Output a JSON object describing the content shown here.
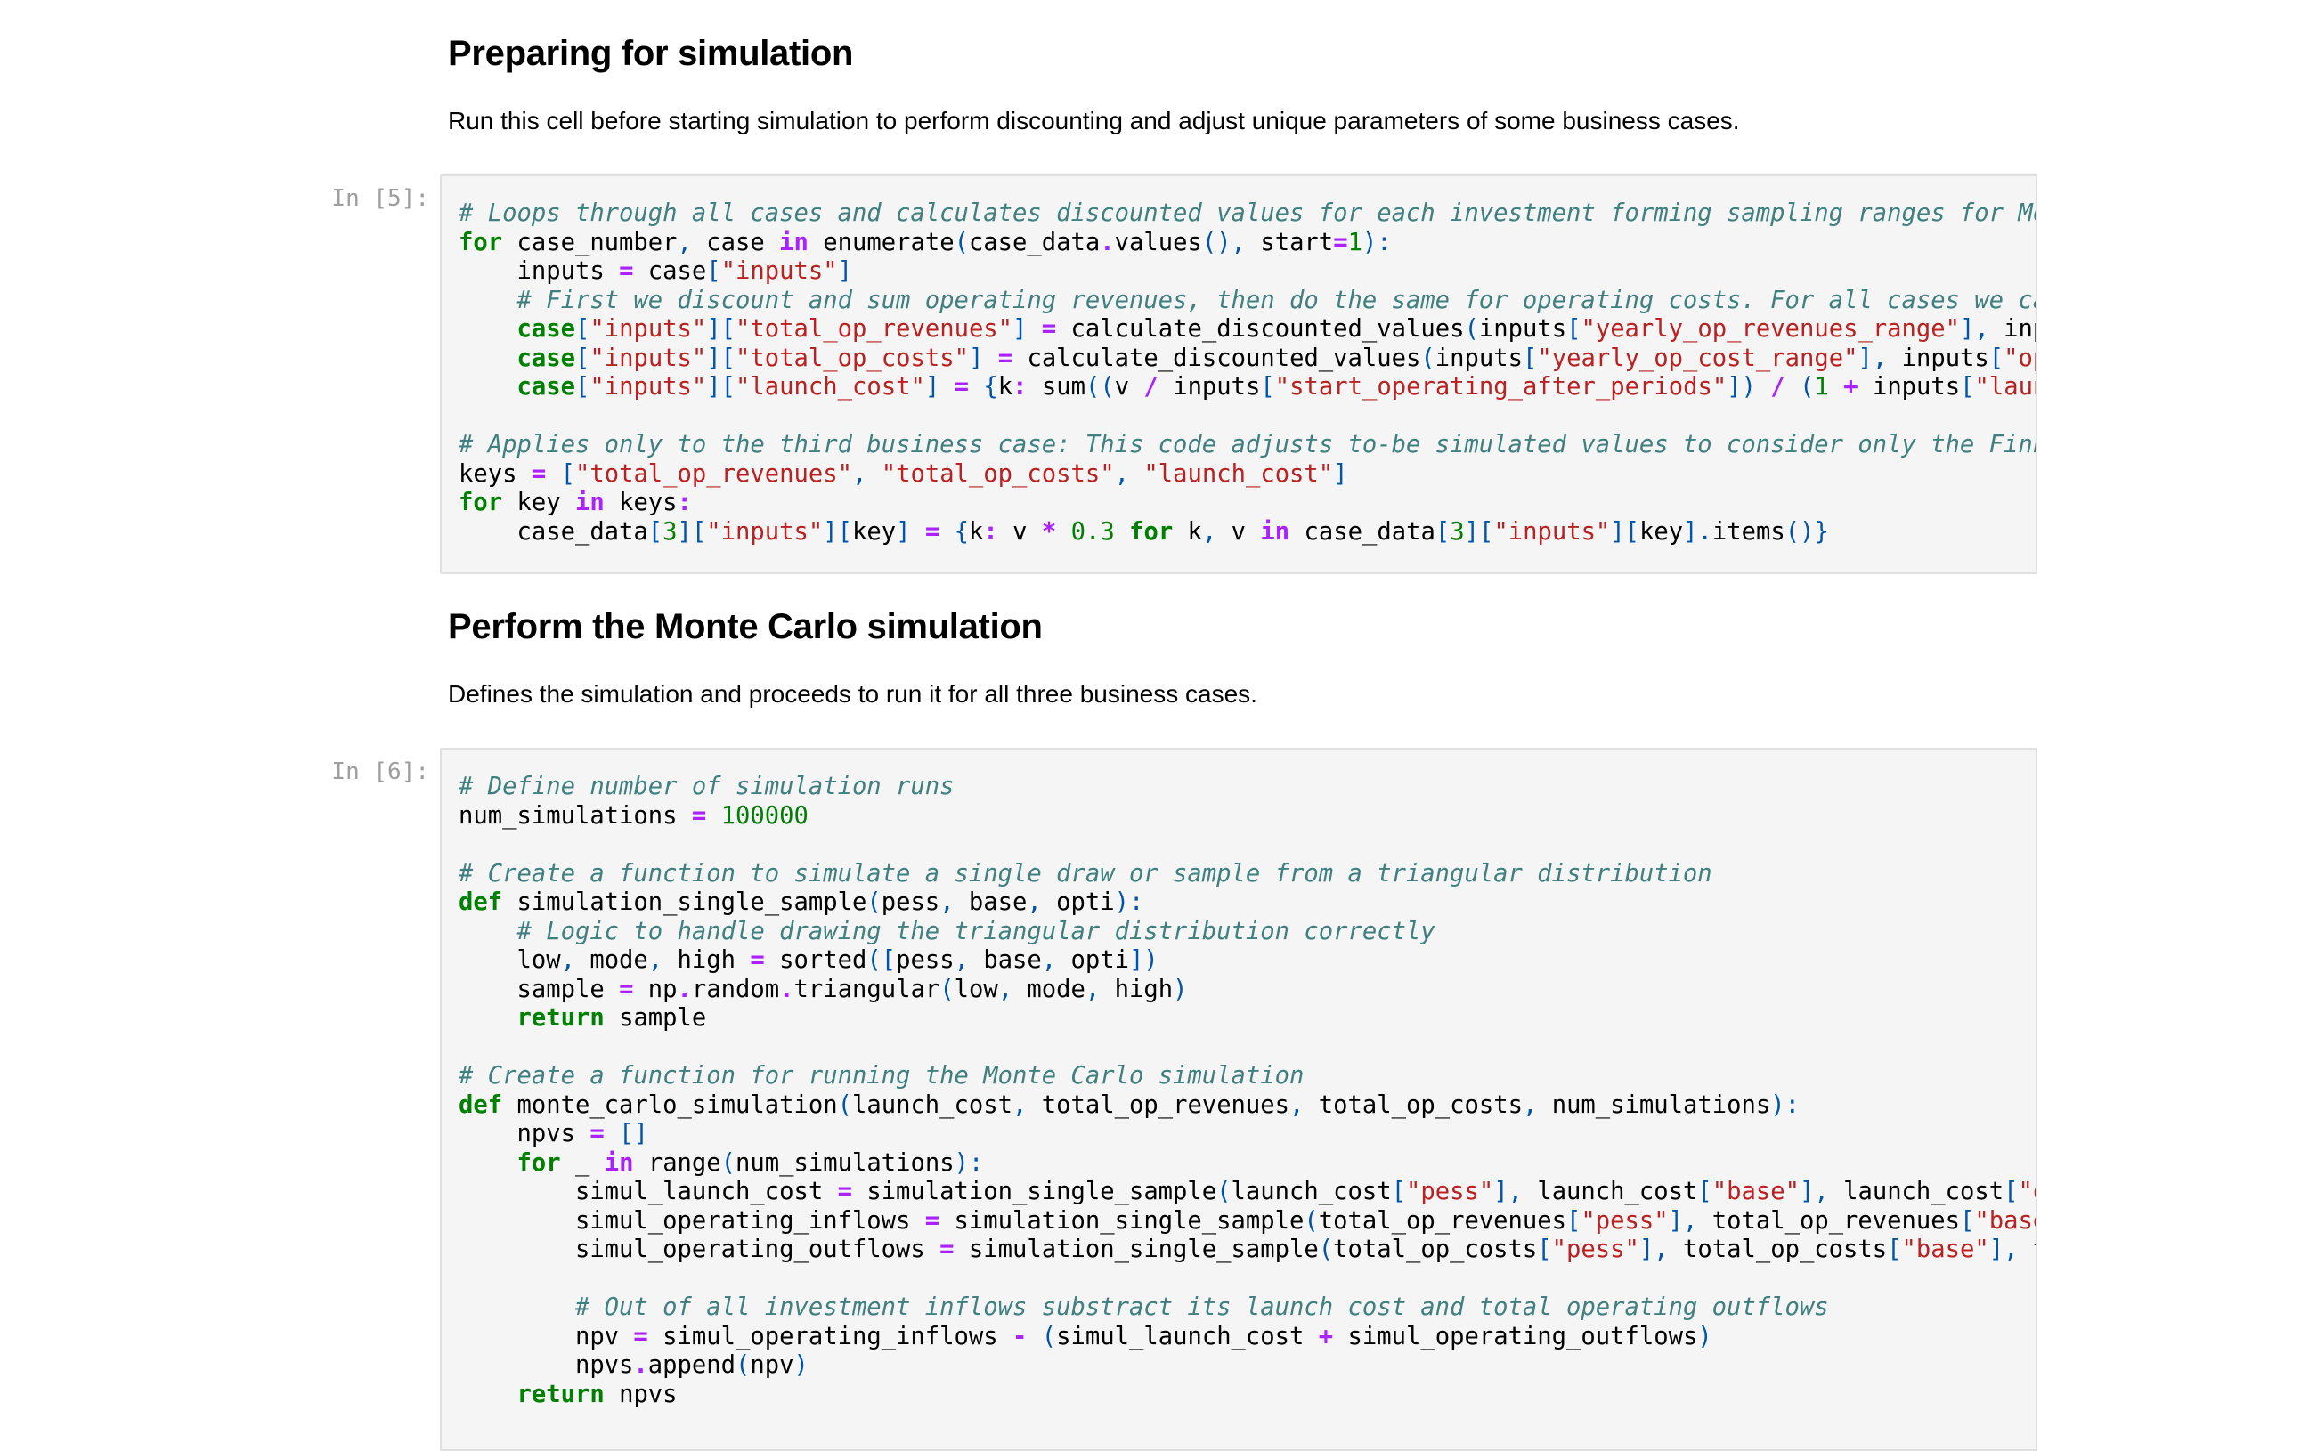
{
  "section1": {
    "heading": "Preparing for simulation",
    "description": "Run this cell before starting simulation to perform discounting and adjust unique parameters of some business cases."
  },
  "cell5": {
    "prompt": "In [5]:",
    "lines": [
      "# Loops through all cases and calculates discounted values for each investment forming sampling ranges for Monte",
      "for case_number, case in enumerate(case_data.values(), start=1):",
      "    inputs = case[\"inputs\"]",
      "    # First we discount and sum operating revenues, then do the same for operating costs. For all cases we calcul",
      "    case[\"inputs\"][\"total_op_revenues\"] = calculate_discounted_values(inputs[\"yearly_op_revenues_range\"], inputs[",
      "    case[\"inputs\"][\"total_op_costs\"] = calculate_discounted_values(inputs[\"yearly_op_cost_range\"], inputs[\"operat",
      "    case[\"inputs\"][\"launch_cost\"] = {k: sum((v / inputs[\"start_operating_after_periods\"]) / (1 + inputs[\"launch_c",
      "",
      "# Applies only to the third business case: This code adjusts to-be simulated values to consider only the Finnish",
      "keys = [\"total_op_revenues\", \"total_op_costs\", \"launch_cost\"]",
      "for key in keys:",
      "    case_data[3][\"inputs\"][key] = {k: v * 0.3 for k, v in case_data[3][\"inputs\"][key].items()}"
    ]
  },
  "section2": {
    "heading": "Perform the Monte Carlo simulation",
    "description": "Defines the simulation and proceeds to run it for all three business cases."
  },
  "cell6": {
    "prompt": "In [6]:",
    "lines": [
      "# Define number of simulation runs",
      "num_simulations = 100000",
      "",
      "# Create a function to simulate a single draw or sample from a triangular distribution",
      "def simulation_single_sample(pess, base, opti):",
      "    # Logic to handle drawing the triangular distribution correctly",
      "    low, mode, high = sorted([pess, base, opti])",
      "    sample = np.random.triangular(low, mode, high)",
      "    return sample",
      "",
      "# Create a function for running the Monte Carlo simulation",
      "def monte_carlo_simulation(launch_cost, total_op_revenues, total_op_costs, num_simulations):",
      "    npvs = []",
      "    for _ in range(num_simulations):",
      "        simul_launch_cost = simulation_single_sample(launch_cost[\"pess\"], launch_cost[\"base\"], launch_cost[\"opti\"",
      "        simul_operating_inflows = simulation_single_sample(total_op_revenues[\"pess\"], total_op_revenues[\"base\"], ",
      "        simul_operating_outflows = simulation_single_sample(total_op_costs[\"pess\"], total_op_costs[\"base\"], total",
      "",
      "        # Out of all investment inflows substract its launch cost and total operating outflows",
      "        npv = simul_operating_inflows - (simul_launch_cost + simul_operating_outflows)",
      "        npvs.append(npv)",
      "    return npvs"
    ]
  }
}
